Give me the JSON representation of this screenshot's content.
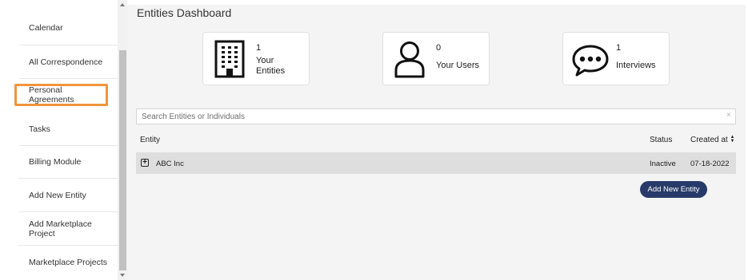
{
  "sidebar": {
    "items": [
      {
        "label": "Calendar"
      },
      {
        "label": "All Correspondence"
      },
      {
        "label": "Personal Agreements"
      },
      {
        "label": "Tasks"
      },
      {
        "label": "Billing Module"
      },
      {
        "label": "Add New Entity"
      },
      {
        "label": "Add Marketplace Project"
      },
      {
        "label": "Marketplace Projects"
      }
    ]
  },
  "main": {
    "title": "Entities Dashboard",
    "cards": [
      {
        "icon": "building-icon",
        "count": "1",
        "label_line1": "Your",
        "label_line2": "Entities"
      },
      {
        "icon": "user-icon",
        "count": "0",
        "label_line1": "Your Users"
      },
      {
        "icon": "chat-bubble-icon",
        "count": "1",
        "label_line1": "Interviews"
      }
    ],
    "search": {
      "placeholder": "Search Entities or Individuals",
      "value": "",
      "clear": "×"
    },
    "table": {
      "columns": {
        "entity": "Entity",
        "status": "Status",
        "created": "Created at"
      },
      "rows": [
        {
          "entity": "ABC Inc",
          "status": "Inactive",
          "created": "07-18-2022"
        }
      ]
    },
    "add_button": "Add New Entity"
  },
  "colors": {
    "active_outline": "#f0953a",
    "primary_button": "#283a69",
    "row_background": "#dedede",
    "page_background": "#f4f4f4"
  }
}
